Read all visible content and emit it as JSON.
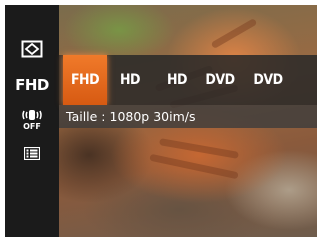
{
  "sidebar": {
    "items": [
      {
        "icon": "scene-frame-icon"
      },
      {
        "label": "FHD"
      },
      {
        "icon": "stabilizer-off-icon",
        "sub_label": "OFF"
      },
      {
        "icon": "menu-list-icon"
      }
    ]
  },
  "resolution_menu": {
    "options": [
      "FHD",
      "HD",
      "HD",
      "DVD",
      "DVD"
    ],
    "selected_index": 0
  },
  "info": {
    "text": "Taille : 1080p 30im/s"
  },
  "colors": {
    "sidebar_bg": "#1b1b1b",
    "accent": "#e8671b",
    "menu_bg": "#282828"
  }
}
